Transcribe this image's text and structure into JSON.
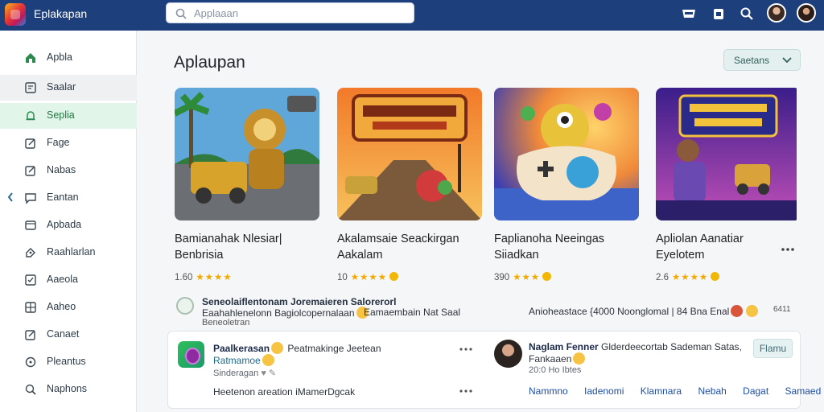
{
  "header": {
    "app_name": "Eplakapan",
    "search_placeholder": "Applaaan",
    "icons": [
      "store-icon",
      "calendar-icon",
      "search-icon",
      "avatar",
      "avatar"
    ]
  },
  "sidebar": {
    "items": [
      {
        "label": "Apbla",
        "icon": "home-icon"
      },
      {
        "label": "Saalar",
        "icon": "doc-icon"
      },
      {
        "label": "Seplia",
        "icon": "bell-icon"
      },
      {
        "label": "Fage",
        "icon": "edit-icon"
      },
      {
        "label": "Nabas",
        "icon": "edit-icon"
      },
      {
        "label": "Eantan",
        "icon": "chat-icon"
      },
      {
        "label": "Apbada",
        "icon": "window-icon"
      },
      {
        "label": "Raahlarlan",
        "icon": "tag-icon"
      },
      {
        "label": "Aaeola",
        "icon": "box-icon"
      },
      {
        "label": "Aaheo",
        "icon": "gallery-icon"
      },
      {
        "label": "Canaet",
        "icon": "edit-icon"
      },
      {
        "label": "Pleantus",
        "icon": "circle-icon"
      },
      {
        "label": "Naphons",
        "icon": "search-icon"
      }
    ]
  },
  "main": {
    "title": "Aplaupan",
    "sort_label": "Saetans",
    "games": [
      {
        "title_line1": "Bamianahak Nlesiar|",
        "title_line2": "Benbrisia",
        "rating": "1.60"
      },
      {
        "title_line1": "Akalamsaie Seackirgan",
        "title_line2": "Aakalam",
        "rating": "10"
      },
      {
        "title_line1": "Faplianoha Neeingas",
        "title_line2": "Siiadkan",
        "rating": "390"
      },
      {
        "title_line1": "Apliolan Aanatiar",
        "title_line2": "Eyelotem",
        "rating": "2.6"
      }
    ],
    "activity": {
      "line1": "Seneolaiflentonam Joremaieren Salorerorl",
      "line2a": "Eaahahlenelonn Bagiolcopernalaan",
      "line2b": "Eamaembain Nat Saal",
      "line3": "Beneoletran",
      "right": "Anioheastace {4000 Noonglomal | 84 Bna Enal",
      "right_count": "6411"
    },
    "comment_left": {
      "name": "Paalkerasan",
      "action": "Peatmakinge Jeetean",
      "sub": "Ratmamoe",
      "time": "Sinderagan",
      "body": "Heetenon areation iMamerDgcak"
    },
    "comment_right": {
      "name": "Naglam Fenner",
      "text": "Glderdeecortab Sademan Satas,",
      "sub": "Fankaaen",
      "time": "20:0 Ho Ibtes",
      "follow": "Flamu",
      "links": [
        "Nammno",
        "Iadenomi",
        "Klamnara",
        "Nebah",
        "Dagat",
        "Samaed"
      ]
    }
  }
}
